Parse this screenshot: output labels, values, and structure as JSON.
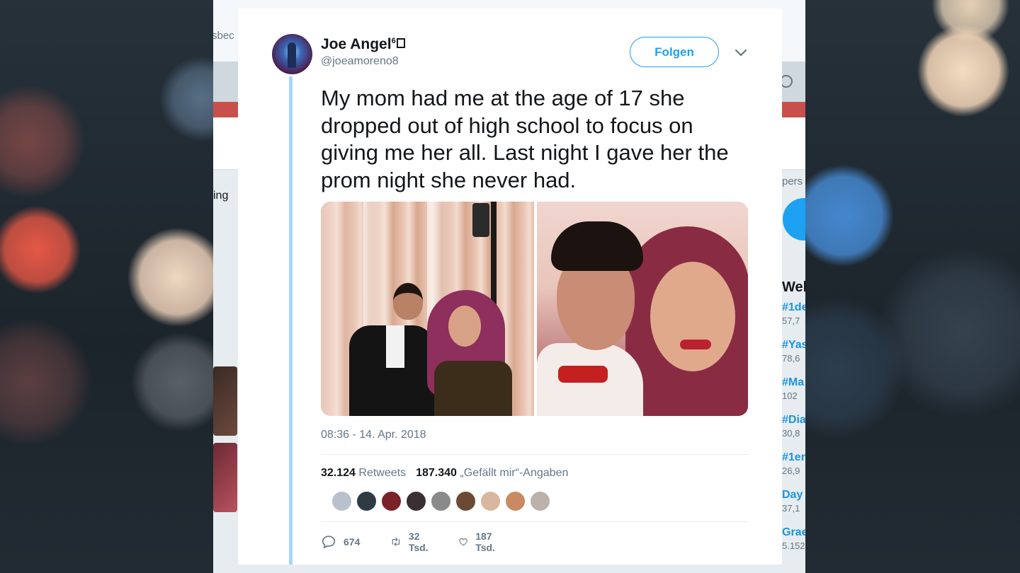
{
  "background_page": {
    "partial_top_text": "sbec",
    "partial_left_text": "ing",
    "right_panel": {
      "partial_text": "pers",
      "heading": "Wel",
      "trends": [
        {
          "tag": "#1de",
          "count": "57,7"
        },
        {
          "tag": "#Yas",
          "count": "78,6"
        },
        {
          "tag": "#Ma",
          "count": "102"
        },
        {
          "tag": "#Dia",
          "count": "30,8"
        },
        {
          "tag": "#1er",
          "count": "26,9"
        },
        {
          "tag": "Day",
          "count": "37,1"
        },
        {
          "tag": "Grae",
          "count": "5.152"
        }
      ]
    }
  },
  "tweet": {
    "author": {
      "name": "Joe Angel",
      "superscript": "6",
      "handle": "@joeamoreno8"
    },
    "follow_label": "Folgen",
    "text": "My mom had me at the age of 17 she dropped out of high school to focus on giving me her all. Last night I gave her the prom night she never had.",
    "timestamp": "08:36 - 14. Apr. 2018",
    "stats": {
      "retweets_count": "32.124",
      "retweets_label": "Retweets",
      "likes_count": "187.340",
      "likes_label": "„Gefällt mir“-Angaben"
    },
    "likers": [
      {
        "color": "#b9c2cc"
      },
      {
        "color": "#2e3b45"
      },
      {
        "color": "#7b2228"
      },
      {
        "color": "#3a2f33"
      },
      {
        "color": "#8a8a8a"
      },
      {
        "color": "#6b4a34"
      },
      {
        "color": "#d9b79f"
      },
      {
        "color": "#c98a62"
      },
      {
        "color": "#bcb2ac"
      }
    ],
    "actions": {
      "replies": "674",
      "retweets": "32 Tsd.",
      "likes": "187 Tsd."
    }
  },
  "colors": {
    "accent": "#1da1f2",
    "thread_line": "#a6d6f6",
    "secondary_text": "#657786"
  }
}
